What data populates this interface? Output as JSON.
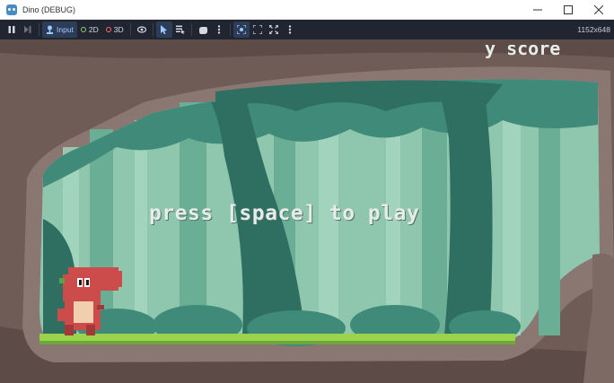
{
  "window": {
    "title": "Dino (DEBUG)",
    "minimize": "minimize",
    "maximize": "maximize",
    "close": "close"
  },
  "toolbar": {
    "input_label": "Input",
    "mode_2d": "2D",
    "mode_3d": "3D",
    "resolution": "1152x648"
  },
  "game": {
    "prompt": "press [space] to play",
    "score_partial": "y score"
  },
  "colors": {
    "toolbar_bg": "#202531",
    "accent": "#478cbf",
    "dot_2d": "#8ed66a",
    "dot_3d": "#ff6b6b",
    "cave_rock": "#6f5c57",
    "forest_light": "#8ec7ad",
    "grass": "#9bd44a",
    "dino": "#cc4b4b"
  }
}
